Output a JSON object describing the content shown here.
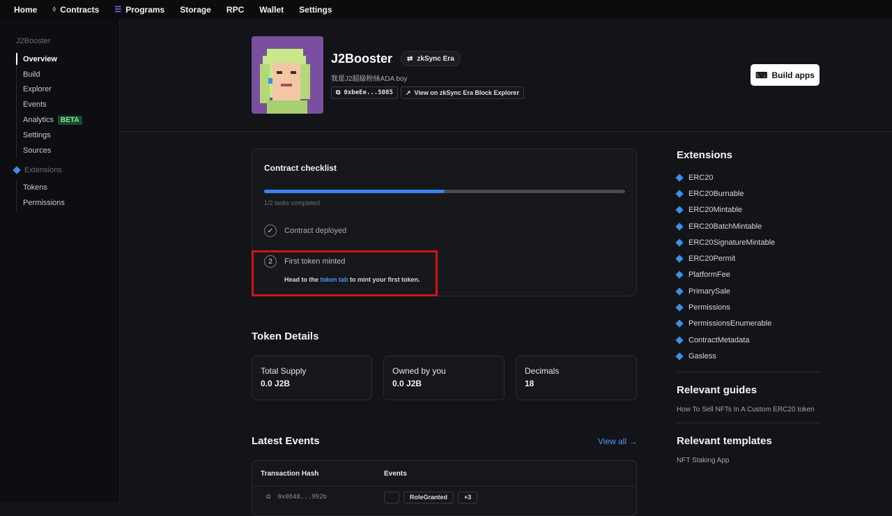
{
  "topnav": {
    "items": [
      {
        "label": "Home",
        "icon": ""
      },
      {
        "label": "Contracts",
        "icon": "ethereum-icon"
      },
      {
        "label": "Programs",
        "icon": "solana-icon"
      },
      {
        "label": "Storage",
        "icon": ""
      },
      {
        "label": "RPC",
        "icon": ""
      },
      {
        "label": "Wallet",
        "icon": ""
      },
      {
        "label": "Settings",
        "icon": ""
      }
    ]
  },
  "sidebar": {
    "section_title": "J2Booster",
    "items": [
      "Overview",
      "Build",
      "Explorer",
      "Events",
      "Analytics",
      "Settings",
      "Sources"
    ],
    "active": "Overview",
    "analytics_badge": "BETA",
    "extensions_title": "Extensions",
    "extension_items": [
      "Tokens",
      "Permissions"
    ]
  },
  "contract": {
    "name": "J2Booster",
    "chain": "zkSync Era",
    "description": "我是J2超級粉絲ADA boy",
    "address": "0xbeEe...5085",
    "explorer_label": "View on zkSync Era Block Explorer"
  },
  "build_button": "Build apps",
  "checklist": {
    "title": "Contract checklist",
    "progress": 0.5,
    "tasks_completed": "1/2 tasks completed",
    "task1": "Contract deployed",
    "task2_number": "2",
    "task2": "First token minted",
    "task2_desc_pre": "Head to the",
    "task2_link": "token tab",
    "task2_desc_post": "to mint your first token."
  },
  "token_details": {
    "title": "Token Details",
    "cards": [
      {
        "label": "Total Supply",
        "value": "0.0 J2B"
      },
      {
        "label": "Owned by you",
        "value": "0.0 J2B"
      },
      {
        "label": "Decimals",
        "value": "18"
      }
    ]
  },
  "latest_events": {
    "title": "Latest Events",
    "view_all": "View all →",
    "columns": [
      "Transaction Hash",
      "Events"
    ],
    "rows": [
      {
        "hash": "0x0848...992b",
        "events": [
          "",
          "RoleGranted",
          "+3"
        ]
      }
    ]
  },
  "extensions": {
    "title": "Extensions",
    "items": [
      "ERC20",
      "ERC20Burnable",
      "ERC20Mintable",
      "ERC20BatchMintable",
      "ERC20SignatureMintable",
      "ERC20Permit",
      "PlatformFee",
      "PrimarySale",
      "Permissions",
      "PermissionsEnumerable",
      "ContractMetadata",
      "Gasless"
    ]
  },
  "guides": {
    "title": "Relevant guides",
    "items": [
      "How To Sell NFTs In A Custom ERC20 token"
    ]
  },
  "templates": {
    "title": "Relevant templates",
    "items": [
      "NFT Staking App"
    ]
  },
  "colors": {
    "accent": "#3a82f0",
    "link": "#4f97f5",
    "highlight": "#d21414",
    "beta_bg": "#1e4a2e"
  }
}
